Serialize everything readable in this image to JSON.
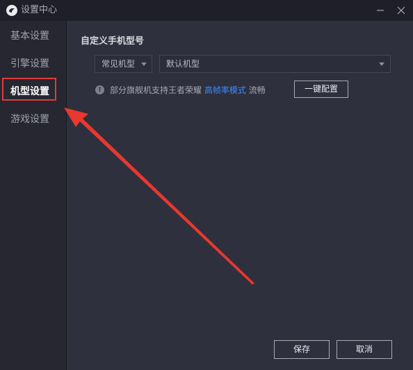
{
  "window": {
    "title": "设置中心"
  },
  "sidebar": {
    "items": [
      {
        "label": "基本设置"
      },
      {
        "label": "引擎设置"
      },
      {
        "label": "机型设置"
      },
      {
        "label": "游戏设置"
      }
    ],
    "active": "机型设置"
  },
  "model_settings": {
    "section_title": "自定义手机型号",
    "category_select": {
      "value": "常见机型"
    },
    "model_select": {
      "value": "默认机型"
    },
    "info": {
      "prefix": "部分旗舰机支持王者荣耀",
      "link": "高帧率模式",
      "suffix": "流畅"
    },
    "one_key_button": "一键配置"
  },
  "footer": {
    "save_label": "保存",
    "cancel_label": "取消"
  },
  "colors": {
    "accent_link": "#3b8bff",
    "highlight_red": "#e23b3b",
    "background": "#2f303d",
    "sidebar_bg": "#262731"
  },
  "icons": {
    "app": "app-logo-icon",
    "minimize": "minimize-icon",
    "close": "close-icon",
    "info": "info-icon",
    "dropdown": "chevron-down-icon",
    "annotation": "red-arrow-annotation"
  }
}
